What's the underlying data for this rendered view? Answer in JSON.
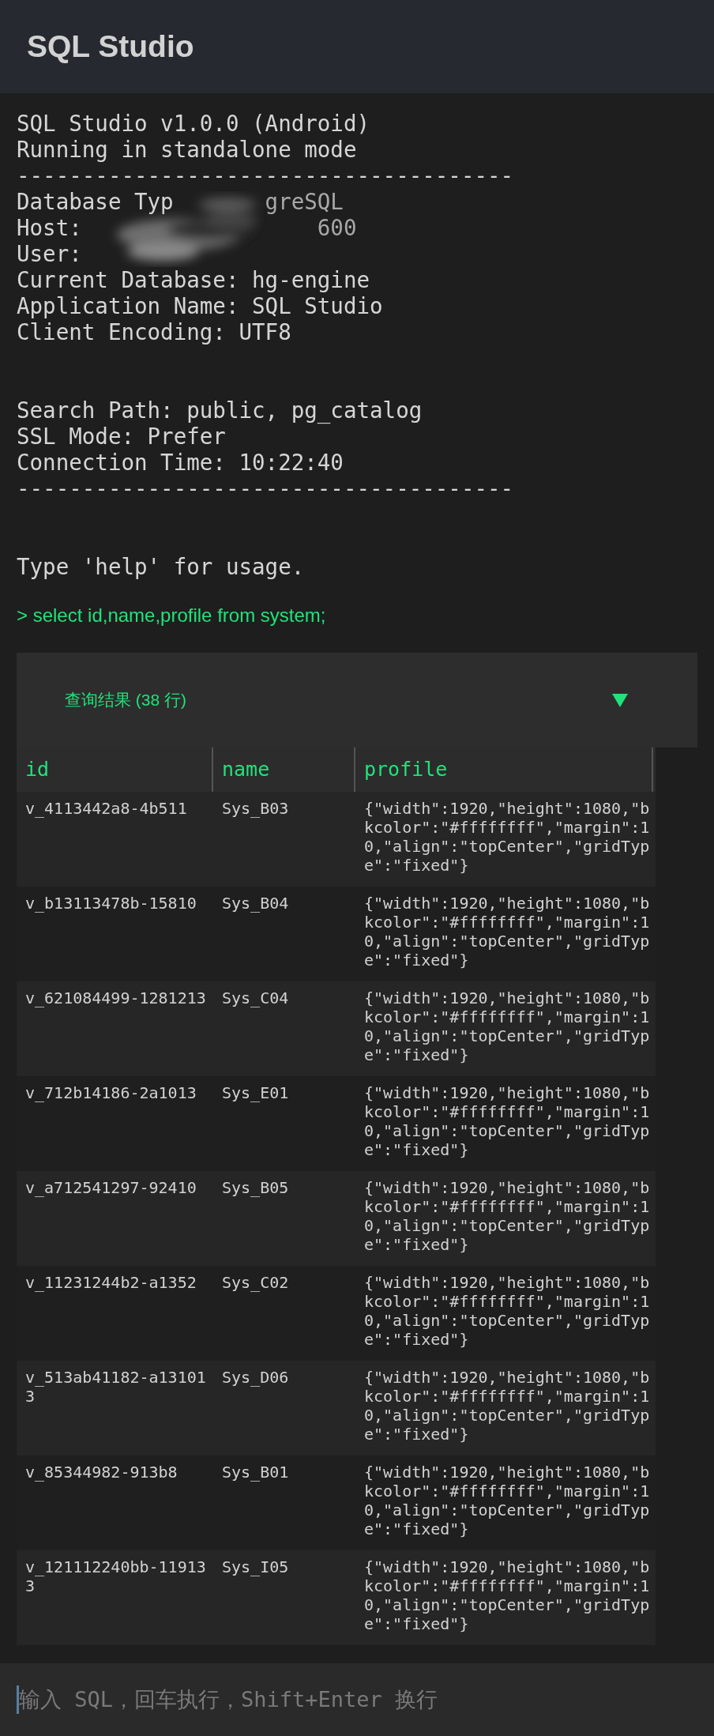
{
  "app_bar": {
    "title": "SQL Studio"
  },
  "console": {
    "lines": [
      {
        "kind": "text",
        "text": "SQL Studio v1.0.0 (Android)"
      },
      {
        "kind": "text",
        "text": "Running in standalone mode"
      },
      {
        "kind": "text",
        "text": "--------------------------------------"
      },
      {
        "kind": "redacted",
        "text": "Database Typ",
        "tail": "greSQL"
      },
      {
        "kind": "redacted",
        "text": "Host:",
        "tail": "600"
      },
      {
        "kind": "redacted",
        "text": "User:"
      },
      {
        "kind": "text",
        "text": "Current Database: hg-engine"
      },
      {
        "kind": "text",
        "text": "Application Name: SQL Studio"
      },
      {
        "kind": "text",
        "text": "Client Encoding: UTF8"
      },
      {
        "kind": "blank"
      },
      {
        "kind": "blank"
      },
      {
        "kind": "text",
        "text": "Search Path: public, pg_catalog"
      },
      {
        "kind": "text",
        "text": "SSL Mode: Prefer"
      },
      {
        "kind": "text",
        "text": "Connection Time: 10:22:40"
      },
      {
        "kind": "text",
        "text": "--------------------------------------"
      },
      {
        "kind": "blank"
      },
      {
        "kind": "blank"
      },
      {
        "kind": "text",
        "text": "Type 'help' for usage."
      }
    ],
    "command": "> select id,name,profile from system;"
  },
  "result": {
    "title": "查询结果 (38 行)",
    "expanded": true,
    "columns": [
      "id",
      "name",
      "profile"
    ],
    "rows": [
      [
        "v_4113442a8-4b511",
        "Sys_B03",
        "{\"width\":1920,\"height\":1080,\"bkcolor\":\"#ffffffff\",\"margin\":10,\"align\":\"topCenter\",\"gridType\":\"fixed\"}"
      ],
      [
        "v_b13113478b-15810",
        "Sys_B04",
        "{\"width\":1920,\"height\":1080,\"bkcolor\":\"#ffffffff\",\"margin\":10,\"align\":\"topCenter\",\"gridType\":\"fixed\"}"
      ],
      [
        "v_621084499-1281213",
        "Sys_C04",
        "{\"width\":1920,\"height\":1080,\"bkcolor\":\"#ffffffff\",\"margin\":10,\"align\":\"topCenter\",\"gridType\":\"fixed\"}"
      ],
      [
        "v_712b14186-2a1013",
        "Sys_E01",
        "{\"width\":1920,\"height\":1080,\"bkcolor\":\"#ffffffff\",\"margin\":10,\"align\":\"topCenter\",\"gridType\":\"fixed\"}"
      ],
      [
        "v_a712541297-92410",
        "Sys_B05",
        "{\"width\":1920,\"height\":1080,\"bkcolor\":\"#ffffffff\",\"margin\":10,\"align\":\"topCenter\",\"gridType\":\"fixed\"}"
      ],
      [
        "v_11231244b2-a1352",
        "Sys_C02",
        "{\"width\":1920,\"height\":1080,\"bkcolor\":\"#ffffffff\",\"margin\":10,\"align\":\"topCenter\",\"gridType\":\"fixed\"}"
      ],
      [
        "v_513ab41182-a131013",
        "Sys_D06",
        "{\"width\":1920,\"height\":1080,\"bkcolor\":\"#ffffffff\",\"margin\":10,\"align\":\"topCenter\",\"gridType\":\"fixed\"}"
      ],
      [
        "v_85344982-913b8",
        "Sys_B01",
        "{\"width\":1920,\"height\":1080,\"bkcolor\":\"#ffffffff\",\"margin\":10,\"align\":\"topCenter\",\"gridType\":\"fixed\"}"
      ],
      [
        "v_121112240bb-119133",
        "Sys_I05",
        "{\"width\":1920,\"height\":1080,\"bkcolor\":\"#ffffffff\",\"margin\":10,\"align\":\"topCenter\",\"gridType\":\"fixed\"}"
      ]
    ]
  },
  "input": {
    "placeholder": "输入 SQL，回车执行，Shift+Enter 换行"
  }
}
